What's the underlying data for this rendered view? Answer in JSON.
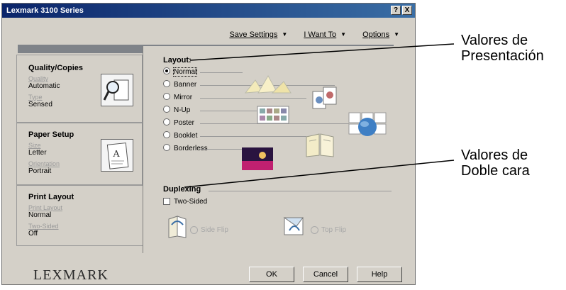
{
  "window": {
    "title": "Lexmark 3100 Series",
    "title_buttons": [
      "?",
      "X"
    ]
  },
  "menubar": [
    {
      "label": "Save Settings"
    },
    {
      "label": "I Want To"
    },
    {
      "label": "Options"
    }
  ],
  "tabs": [
    {
      "title": "Quality/Copies",
      "fields": [
        {
          "label": "Quality",
          "value": "Automatic"
        },
        {
          "label": "Type",
          "value": "Sensed"
        }
      ]
    },
    {
      "title": "Paper Setup",
      "fields": [
        {
          "label": "Size",
          "value": "Letter"
        },
        {
          "label": "Orientation",
          "value": "Portrait"
        }
      ]
    },
    {
      "title": "Print Layout",
      "fields": [
        {
          "label": "Print Layout",
          "value": "Normal"
        },
        {
          "label": "Two-Sided",
          "value": "Off"
        }
      ]
    }
  ],
  "layout": {
    "title": "Layout:",
    "options": [
      "Normal",
      "Banner",
      "Mirror",
      "N-Up",
      "Poster",
      "Booklet",
      "Borderless"
    ],
    "selected": "Normal"
  },
  "duplexing": {
    "title": "Duplexing",
    "two_sided_label": "Two-Sided",
    "two_sided_checked": false,
    "side_flip_label": "Side Flip",
    "top_flip_label": "Top Flip"
  },
  "buttons": {
    "ok": "OK",
    "cancel": "Cancel",
    "help": "Help"
  },
  "logo": "LEXMARK",
  "callouts": {
    "layout_line1": "Valores de",
    "layout_line2": "Presentación",
    "duplex_line1": "Valores de",
    "duplex_line2": "Doble cara"
  }
}
